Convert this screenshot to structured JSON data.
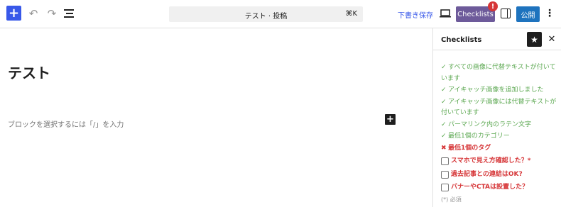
{
  "toolbar": {
    "add_symbol": "+",
    "undo_symbol": "↶",
    "redo_symbol": "↷",
    "more_symbol": "⋮"
  },
  "command_bar": {
    "title": "テスト · 投稿",
    "shortcut": "⌘K"
  },
  "actions": {
    "save_draft": "下書き保存",
    "checklists": "Checklists",
    "badge": "!",
    "publish": "公開"
  },
  "editor": {
    "post_title": "テスト",
    "block_placeholder": "ブロックを選択するには「/」を入力",
    "inserter_symbol": "+"
  },
  "sidebar": {
    "title": "Checklists",
    "star_symbol": "★",
    "close_symbol": "✕",
    "items": [
      {
        "status": "done",
        "mark": "✓",
        "label": "すべての画像に代替テキストが付いています"
      },
      {
        "status": "done",
        "mark": "✓",
        "label": "アイキャッチ画像を追加しました"
      },
      {
        "status": "done",
        "mark": "✓",
        "label": "アイキャッチ画像には代替テキストが付いています"
      },
      {
        "status": "done",
        "mark": "✓",
        "label": "パーマリンク内のラテン文字"
      },
      {
        "status": "done",
        "mark": "✓",
        "label": "最低1個のカテゴリー"
      },
      {
        "status": "fail",
        "mark": "✖",
        "label": "最低1個のタグ"
      },
      {
        "status": "todo",
        "mark": "",
        "label": "スマホで見え方確認した？*"
      },
      {
        "status": "todo",
        "mark": "",
        "label": "過去記事との連結はOK?"
      },
      {
        "status": "todo",
        "mark": "",
        "label": "バナーやCTAは設置した？"
      }
    ],
    "required_note": "(*) 必須"
  },
  "colors": {
    "accent": "#3858e9",
    "checklists_button": "#6d5a9a",
    "publish": "#1e73be",
    "done": "#5aa74f",
    "fail": "#d63638"
  }
}
